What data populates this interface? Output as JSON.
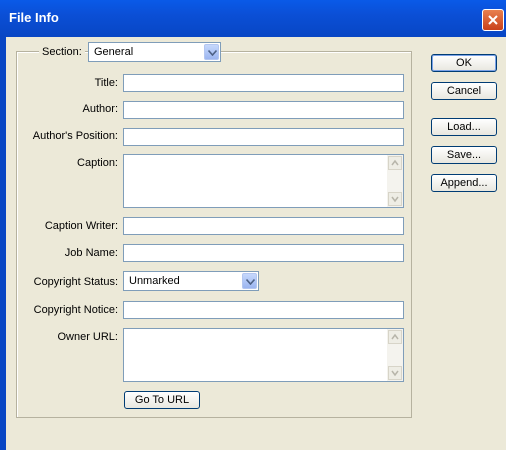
{
  "window": {
    "title": "File Info"
  },
  "section": {
    "label": "Section:",
    "value": "General"
  },
  "fields": [
    {
      "label": "Title:",
      "value": ""
    },
    {
      "label": "Author:",
      "value": ""
    },
    {
      "label": "Author's Position:",
      "value": ""
    },
    {
      "label": "Caption:",
      "value": ""
    },
    {
      "label": "Caption Writer:",
      "value": ""
    },
    {
      "label": "Job Name:",
      "value": ""
    },
    {
      "label": "Copyright Status:",
      "value": "Unmarked"
    },
    {
      "label": "Copyright Notice:",
      "value": ""
    },
    {
      "label": "Owner URL:",
      "value": ""
    }
  ],
  "buttons": {
    "ok": "OK",
    "cancel": "Cancel",
    "load": "Load...",
    "save": "Save...",
    "append": "Append...",
    "goto_url": "Go To URL"
  }
}
